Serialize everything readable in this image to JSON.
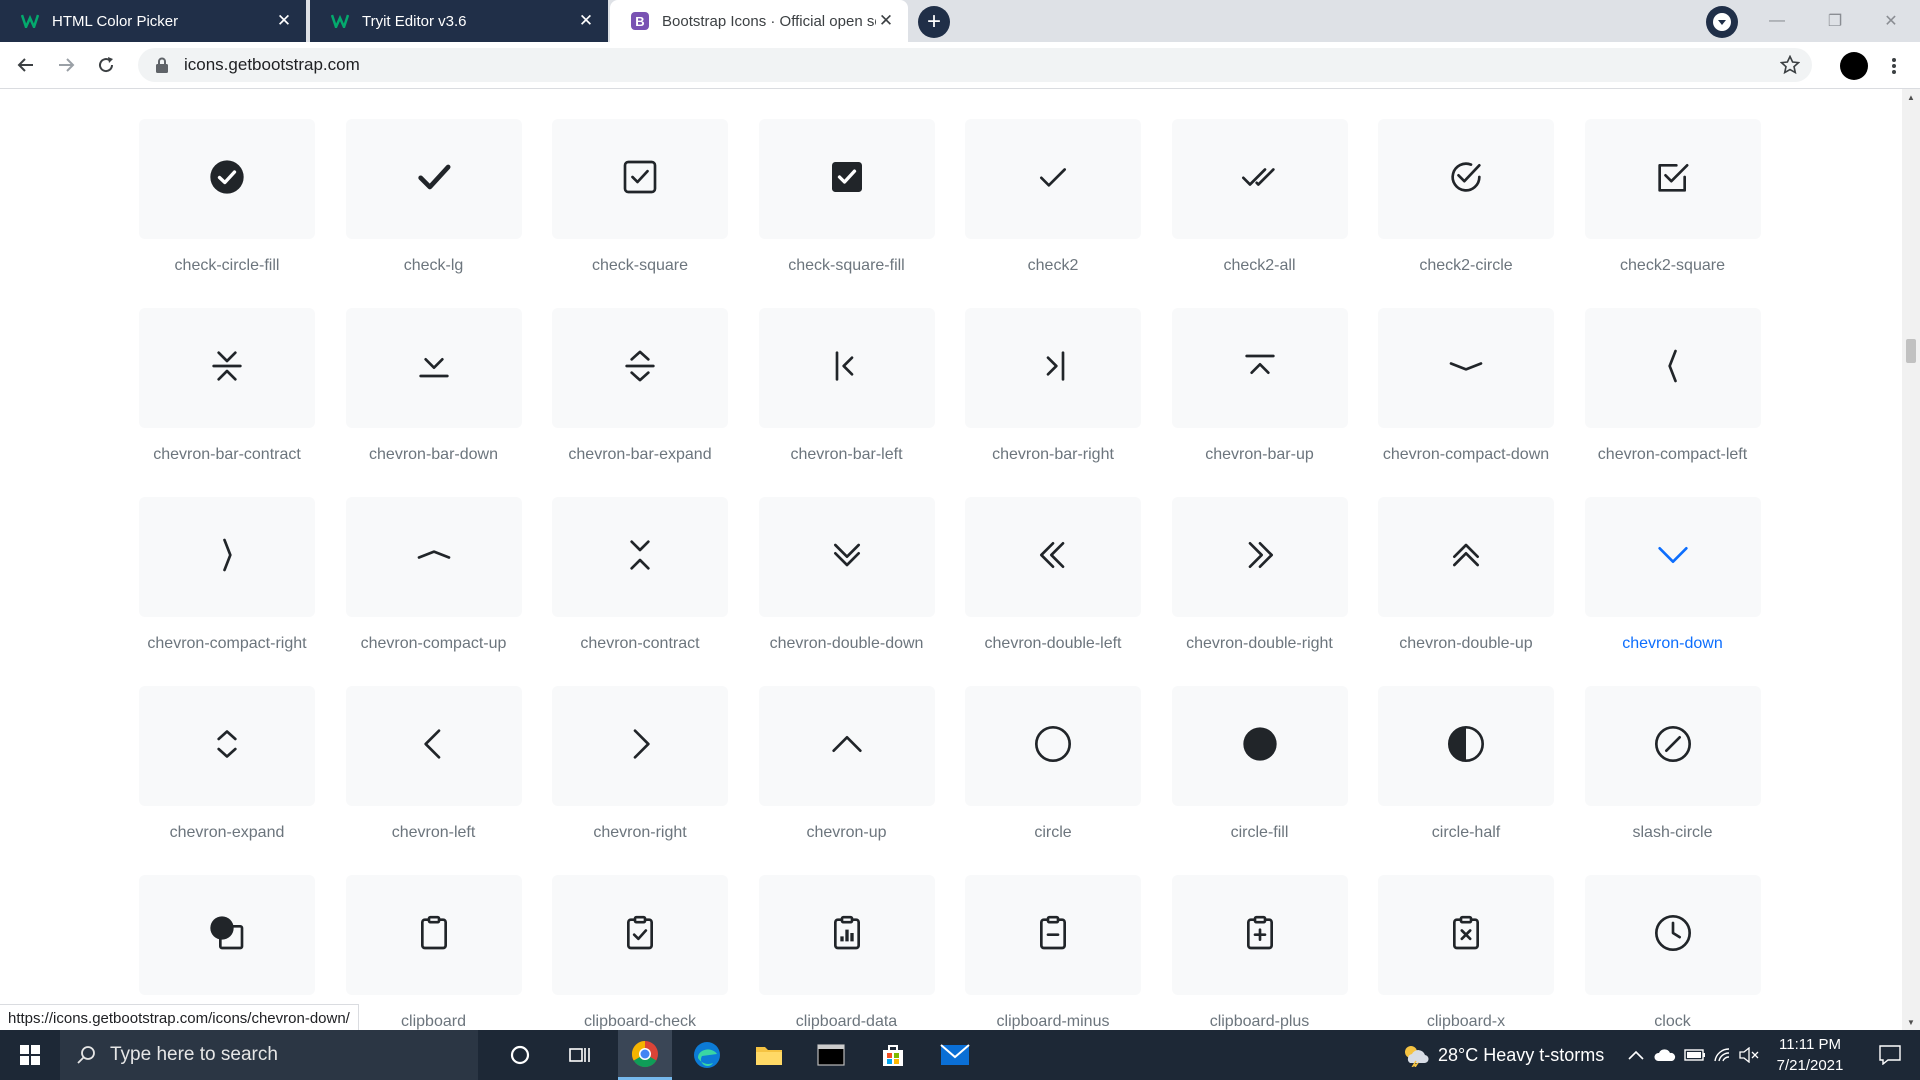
{
  "browser": {
    "tabs": [
      {
        "title": "HTML Color Picker",
        "favicon": "w3schools-icon",
        "state": "inactive"
      },
      {
        "title": "Tryit Editor v3.6",
        "favicon": "w3schools-icon",
        "state": "inactive"
      },
      {
        "title": "Bootstrap Icons · Official open so",
        "favicon": "bootstrap-icon",
        "state": "active"
      }
    ],
    "new_tab_label": "+",
    "url": "icons.getbootstrap.com",
    "status_url": "https://icons.getbootstrap.com/icons/chevron-down/"
  },
  "icons": [
    {
      "name": "check-circle-fill"
    },
    {
      "name": "check-lg"
    },
    {
      "name": "check-square"
    },
    {
      "name": "check-square-fill"
    },
    {
      "name": "check2"
    },
    {
      "name": "check2-all"
    },
    {
      "name": "check2-circle"
    },
    {
      "name": "check2-square"
    },
    {
      "name": "chevron-bar-contract"
    },
    {
      "name": "chevron-bar-down"
    },
    {
      "name": "chevron-bar-expand"
    },
    {
      "name": "chevron-bar-left"
    },
    {
      "name": "chevron-bar-right"
    },
    {
      "name": "chevron-bar-up"
    },
    {
      "name": "chevron-compact-down"
    },
    {
      "name": "chevron-compact-left"
    },
    {
      "name": "chevron-compact-right"
    },
    {
      "name": "chevron-compact-up"
    },
    {
      "name": "chevron-contract"
    },
    {
      "name": "chevron-double-down"
    },
    {
      "name": "chevron-double-left"
    },
    {
      "name": "chevron-double-right"
    },
    {
      "name": "chevron-double-up"
    },
    {
      "name": "chevron-down",
      "selected": true
    },
    {
      "name": "chevron-expand"
    },
    {
      "name": "chevron-left"
    },
    {
      "name": "chevron-right"
    },
    {
      "name": "chevron-up"
    },
    {
      "name": "circle"
    },
    {
      "name": "circle-fill"
    },
    {
      "name": "circle-half"
    },
    {
      "name": "slash-circle"
    },
    {
      "name": "circle-square"
    },
    {
      "name": "clipboard"
    },
    {
      "name": "clipboard-check"
    },
    {
      "name": "clipboard-data"
    },
    {
      "name": "clipboard-minus"
    },
    {
      "name": "clipboard-plus"
    },
    {
      "name": "clipboard-x"
    },
    {
      "name": "clock"
    }
  ],
  "taskbar": {
    "search_placeholder": "Type here to search",
    "weather": "28°C  Heavy t-storms",
    "time": "11:11 PM",
    "date": "7/21/2021"
  },
  "colors": {
    "tab_inactive": "#202f48",
    "tile_bg": "#f8f9fa",
    "label": "#6c757d",
    "selected": "#0d6efd",
    "taskbar": "#1d2836"
  }
}
